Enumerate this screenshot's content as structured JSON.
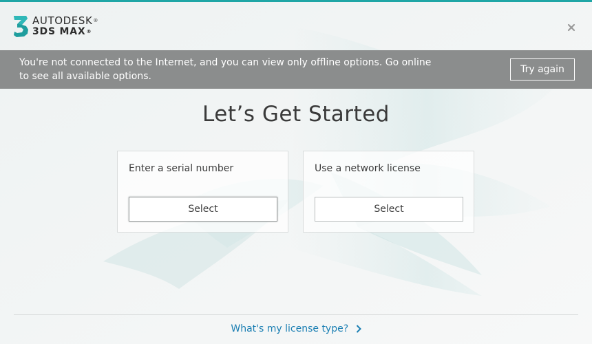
{
  "app": {
    "company": "AUTODESK",
    "product": "3DS MAX",
    "logo_glyph": "3",
    "accent_color": "#1fa6a6"
  },
  "banner": {
    "message": "You're not connected to the Internet, and you can view only offline options. Go online to see all available options.",
    "retry_label": "Try again",
    "background_color": "#8b8d8d"
  },
  "main": {
    "title": "Let’s Get Started",
    "options": [
      {
        "label": "Enter a serial number",
        "button_label": "Select"
      },
      {
        "label": "Use a network license",
        "button_label": "Select"
      }
    ]
  },
  "footer": {
    "link_label": "What's my license type?",
    "link_color": "#1b7fb3"
  },
  "icons": {
    "close": "close-icon",
    "logo": "max-3-logo-icon",
    "chevron": "chevron-right-icon"
  }
}
